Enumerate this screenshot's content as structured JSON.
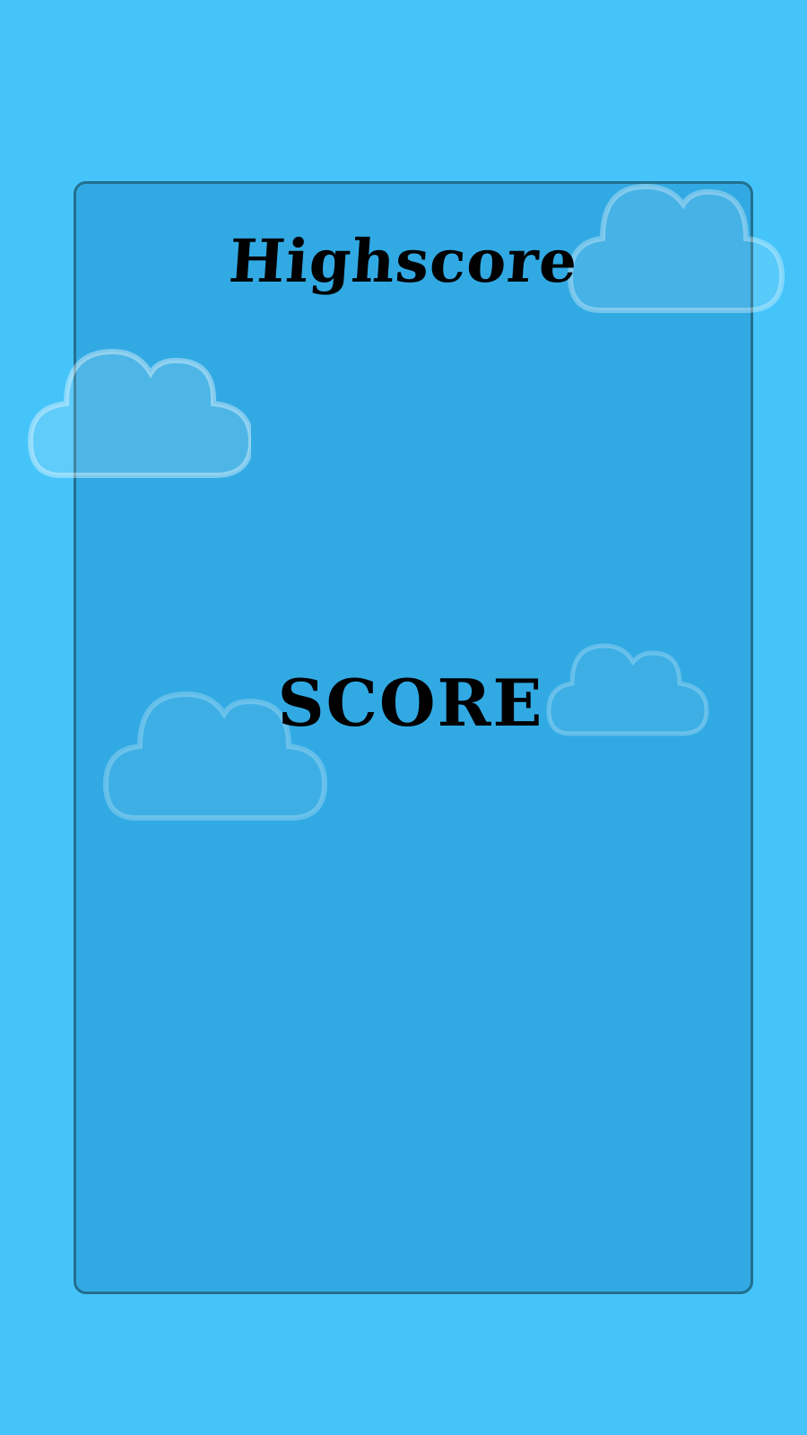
{
  "screen": {
    "highscore_title": "Highscore",
    "score_title": "SCORE"
  },
  "colors": {
    "sky": "#45c4fa",
    "panel": "#29aae2",
    "panel_border": "#22708f",
    "text": "#000000"
  },
  "decorations": {
    "icon": "cloud-icon",
    "count": 4
  }
}
